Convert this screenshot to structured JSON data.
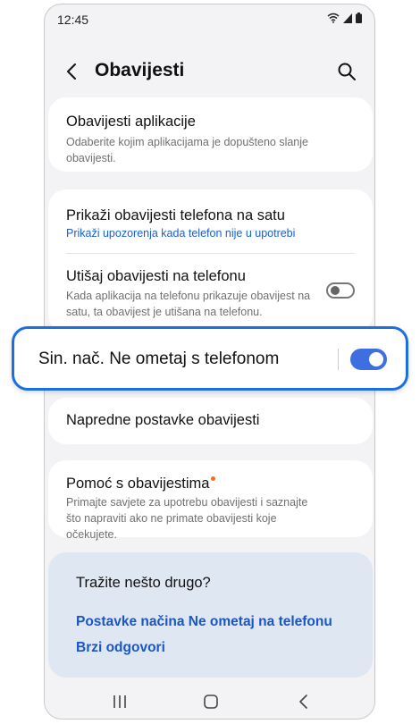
{
  "status_bar": {
    "time": "12:45"
  },
  "header": {
    "title": "Obavijesti"
  },
  "items": {
    "app_notifications": {
      "title": "Obavijesti aplikacije",
      "subtitle": "Odaberite kojim aplikacijama je dopušteno slanje obavijesti."
    },
    "show_on_watch": {
      "title": "Prikaži obavijesti telefona na satu",
      "link": "Prikaži upozorenja kada telefon nije u upotrebi"
    },
    "mute_on_phone": {
      "title": "Utišaj obavijesti na telefonu",
      "subtitle": "Kada aplikacija na telefonu prikazuje obavijest na satu, ta obavijest je utišana na telefonu.",
      "enabled": false
    },
    "sync_dnd": {
      "title": "Sin. nač. Ne ometaj s telefonom",
      "enabled": true
    },
    "advanced": {
      "title": "Napredne postavke obavijesti"
    },
    "help": {
      "title": "Pomoć s obavijestima",
      "subtitle": "Primajte savjete za upotrebu obavijesti i saznajte što napraviti ako ne primate obavijesti koje očekujete.",
      "has_badge": true
    }
  },
  "looking_for": {
    "title": "Tražite nešto drugo?",
    "links": [
      "Postavke načina Ne ometaj na telefonu",
      "Brzi odgovori"
    ]
  },
  "colors": {
    "accent": "#3d6fe1",
    "highlight_border": "#1b6fe0",
    "link": "#1a5fd1",
    "badge": "#f36d21",
    "help_card": "#dfe7f3"
  },
  "icons": [
    "wifi-icon",
    "signal-icon",
    "battery-icon",
    "back-arrow-icon",
    "search-icon",
    "recents-icon",
    "home-icon",
    "back-icon"
  ]
}
